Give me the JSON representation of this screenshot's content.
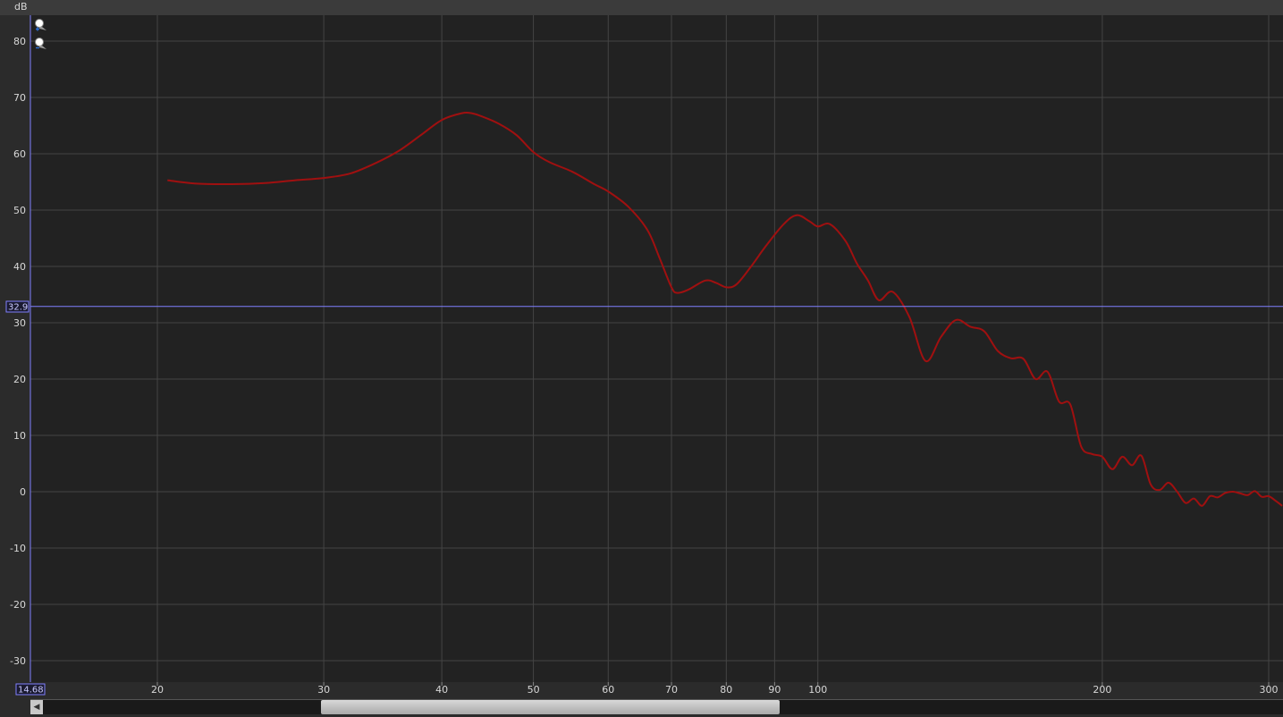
{
  "colors": {
    "background": "#222222",
    "grid": "#444444",
    "curve": "#a01010",
    "cursor": "#8080ff"
  },
  "icons": {
    "zoom_in": "zoom-in-icon",
    "zoom_out": "zoom-out-icon",
    "scroll_left": "arrow-left-icon"
  },
  "cursor": {
    "y_readout": "32.9",
    "x_readout": "14.68"
  },
  "chart_data": {
    "type": "line",
    "ylabel": "dB",
    "xscale": "log",
    "xlim": [
      14.68,
      310
    ],
    "ylim": [
      -33,
      85
    ],
    "grid": true,
    "yticks": [
      80,
      70,
      60,
      50,
      40,
      30,
      20,
      10,
      0,
      -10,
      -20,
      -30
    ],
    "xticks": [
      20,
      30,
      40,
      50,
      60,
      70,
      80,
      90,
      100,
      200,
      300
    ],
    "series": [
      {
        "x": [
          20.5,
          22,
          24,
          26,
          28,
          30,
          32,
          34,
          36,
          38,
          40,
          42,
          43,
          44,
          46,
          48,
          50,
          52,
          55,
          58,
          60,
          63,
          66,
          68,
          70,
          71,
          73,
          76,
          78,
          80,
          82,
          85,
          88,
          92,
          95,
          98,
          100,
          103,
          107,
          110,
          113,
          116,
          120,
          125,
          130,
          135,
          140,
          145,
          150,
          155,
          160,
          165,
          170,
          175,
          180,
          185,
          190,
          195,
          200,
          205,
          210,
          215,
          220,
          225,
          230,
          235,
          240,
          245,
          250,
          255,
          260,
          265,
          270,
          275,
          280,
          285,
          290,
          295,
          300,
          305,
          310
        ],
        "y": [
          55.3,
          54.7,
          54.6,
          54.8,
          55.3,
          55.7,
          56.5,
          58.3,
          60.5,
          63.3,
          66.0,
          67.2,
          67.2,
          66.7,
          65.3,
          63.3,
          60.3,
          58.5,
          56.8,
          54.6,
          53.3,
          50.6,
          46.5,
          41.5,
          36.3,
          35.3,
          35.9,
          37.5,
          37.1,
          36.3,
          36.8,
          40.0,
          43.5,
          47.5,
          49.1,
          48.0,
          47.1,
          47.5,
          44.5,
          40.5,
          37.5,
          34.0,
          35.5,
          31.0,
          23.2,
          27.5,
          30.5,
          29.3,
          28.5,
          25.0,
          23.7,
          23.6,
          20.0,
          21.3,
          16.0,
          15.5,
          8.0,
          6.7,
          6.2,
          4.0,
          6.2,
          4.7,
          6.4,
          1.3,
          0.3,
          1.6,
          0.0,
          -2.0,
          -1.2,
          -2.5,
          -0.8,
          -1.0,
          -0.2,
          0.0,
          -0.3,
          -0.6,
          0.1,
          -0.9,
          -0.8,
          -1.6,
          -2.5
        ]
      }
    ]
  }
}
